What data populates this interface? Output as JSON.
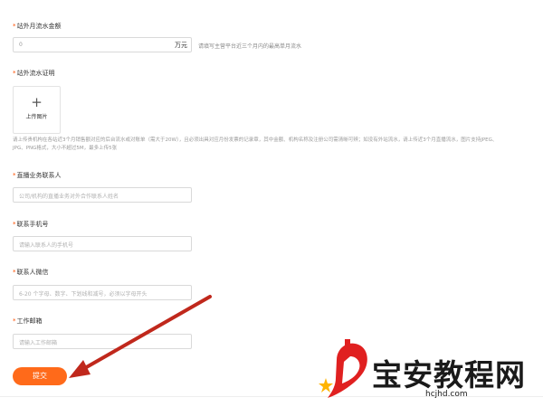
{
  "form": {
    "offsite_flow": {
      "label": "站外月流水金额",
      "value": "0",
      "unit": "万元",
      "hint": "请填写主营平台近三个月内的最高单月流水"
    },
    "flow_proof": {
      "label": "站外流水证明",
      "upload_plus": "+",
      "upload_label": "上传图片",
      "description_line1": "请上传贵机构在各站近3个月销售额对应的后台流水或对账单（需大于20W），且必须出具对应月份发票的记录章，其中金额、机构名称及注册公司需清晰可辨；如没有外站流水，请上传近3个月直播流水，图片支持JPEG、",
      "description_line2": "JPG、PNG格式，大小不超过5M，最多上传5张"
    },
    "contact_name": {
      "label": "直播业务联系人",
      "placeholder": "公司/机构的直播业务对外合作联系人姓名"
    },
    "contact_phone": {
      "label": "联系手机号",
      "placeholder": "请输入联系人的手机号"
    },
    "contact_wechat": {
      "label": "联系人微信",
      "placeholder": "6-20 个字母、数字、下划线和减号，必须以字母开头"
    },
    "work_email": {
      "label": "工作邮箱",
      "placeholder": "请输入工作邮箱"
    },
    "required_mark": "*",
    "submit_label": "提交"
  },
  "watermark": {
    "title": "宝安教程网",
    "url": "hcjhd.com"
  },
  "colors": {
    "accent": "#ff6a1a",
    "arrow": "#c0281c",
    "logo_red": "#e02020"
  }
}
